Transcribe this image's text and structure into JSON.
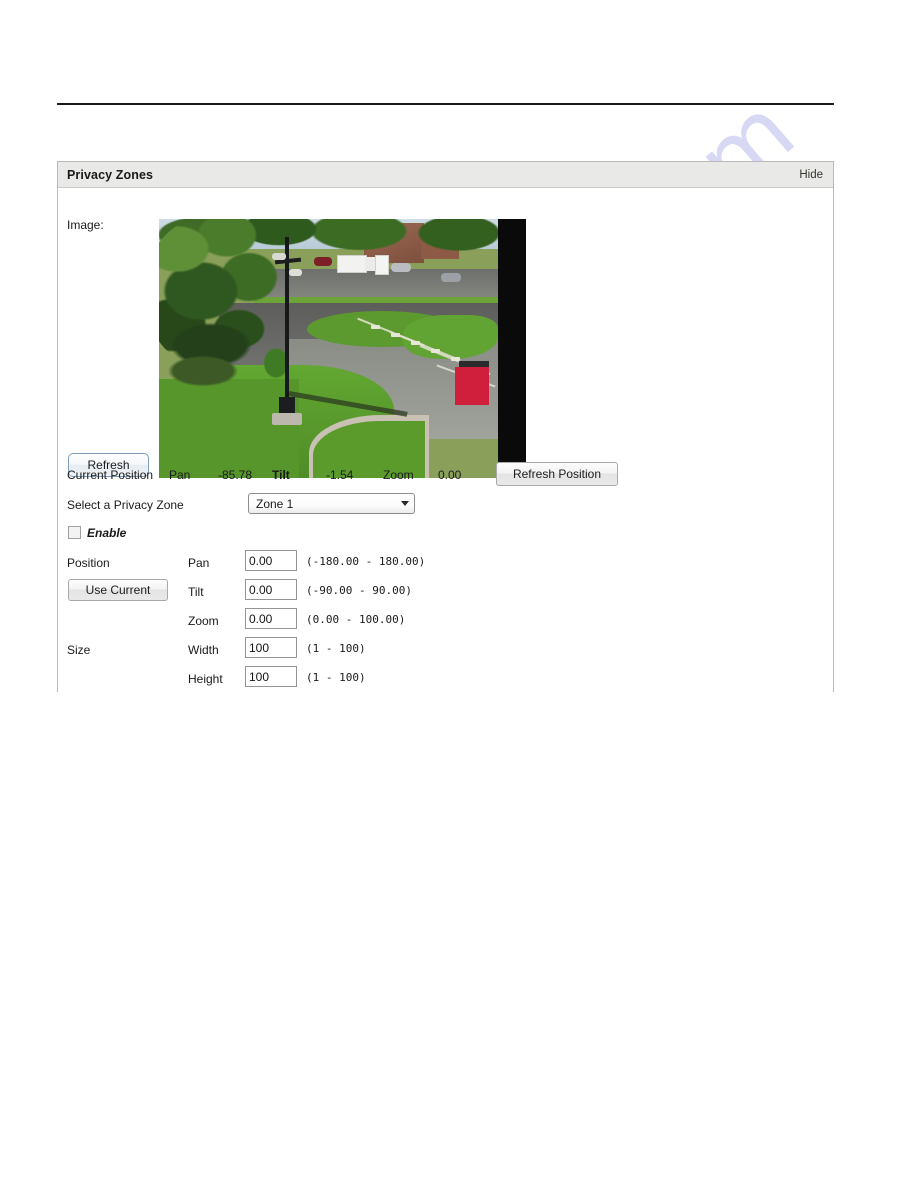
{
  "watermark": {
    "text": "manualshive.com"
  },
  "panel": {
    "title": "Privacy Zones",
    "hide_label": "Hide",
    "image_label": "Image:",
    "refresh_button": "Refresh",
    "current_position": {
      "label": "Current Position",
      "pan_label": "Pan",
      "pan_value": "-85.78",
      "tilt_label": "Tilt",
      "tilt_value": "-1.54",
      "zoom_label": "Zoom",
      "zoom_value": "0.00",
      "refresh_position_button": "Refresh Position"
    },
    "zone_select": {
      "label": "Select a Privacy Zone",
      "value": "Zone 1",
      "options": [
        "Zone 1"
      ]
    },
    "enable": {
      "label": "Enable",
      "checked": false
    },
    "position": {
      "label": "Position",
      "use_current_button": "Use Current",
      "fields": [
        {
          "name": "Pan",
          "value": "0.00",
          "hint": "(-180.00 - 180.00)"
        },
        {
          "name": "Tilt",
          "value": "0.00",
          "hint": "(-90.00 - 90.00)"
        },
        {
          "name": "Zoom",
          "value": "0.00",
          "hint": "(0.00 - 100.00)"
        }
      ]
    },
    "size": {
      "label": "Size",
      "fields": [
        {
          "name": "Width",
          "value": "100",
          "hint": "(1 - 100)"
        },
        {
          "name": "Height",
          "value": "100",
          "hint": "(1 - 100)"
        }
      ]
    }
  },
  "colors": {
    "panel_header_bg": "#e9e9e7",
    "panel_border": "#b9b9b9",
    "watermark": "#d6d8f4",
    "text": "#1a1a1a"
  }
}
